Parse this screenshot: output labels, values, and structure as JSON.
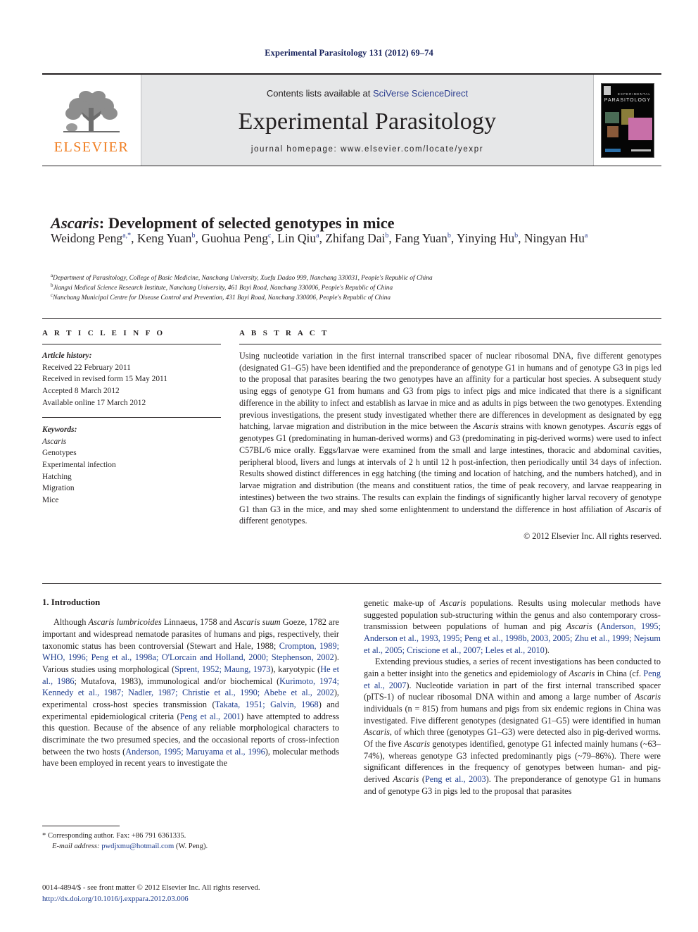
{
  "running_head": "Experimental Parasitology 131 (2012) 69–74",
  "masthead": {
    "contents_prefix": "Contents lists available at ",
    "contents_link": "SciVerse ScienceDirect",
    "journal_title": "Experimental Parasitology",
    "homepage": "journal homepage: www.elsevier.com/locate/yexpr",
    "publisher_logo_label": "ELSEVIER",
    "cover_line1": "EXPERIMENTAL",
    "cover_line2": "PARASITOLOGY"
  },
  "article": {
    "title_italic": "Ascaris",
    "title_rest": ": Development of selected genotypes in mice",
    "authors": [
      {
        "name": "Weidong Peng",
        "sup": "a,*"
      },
      {
        "name": "Keng Yuan",
        "sup": "b"
      },
      {
        "name": "Guohua Peng",
        "sup": "c"
      },
      {
        "name": "Lin Qiu",
        "sup": "a"
      },
      {
        "name": "Zhifang Dai",
        "sup": "b"
      },
      {
        "name": "Fang Yuan",
        "sup": "b"
      },
      {
        "name": "Yinying Hu",
        "sup": "b"
      },
      {
        "name": "Ningyan Hu",
        "sup": "a"
      }
    ],
    "affiliations": [
      {
        "mark": "a",
        "text": "Department of Parasitology, College of Basic Medicine, Nanchang University, Xuefu Dadao 999, Nanchang 330031, People's Republic of China"
      },
      {
        "mark": "b",
        "text": "Jiangxi Medical Science Research Institute, Nanchang University, 461 Bayi Road, Nanchang 330006, People's Republic of China"
      },
      {
        "mark": "c",
        "text": "Nanchang Municipal Centre for Disease Control and Prevention, 431 Bayi Road, Nanchang 330006, People's Republic of China"
      }
    ]
  },
  "info": {
    "heading": "A R T I C L E    I N F O",
    "history_label": "Article history:",
    "history": [
      "Received 22 February 2011",
      "Received in revised form 15 May 2011",
      "Accepted 8 March 2012",
      "Available online 17 March 2012"
    ],
    "keywords_label": "Keywords:",
    "keywords": [
      "Ascaris",
      "Genotypes",
      "Experimental infection",
      "Hatching",
      "Migration",
      "Mice"
    ]
  },
  "abstract": {
    "heading": "A B S T R A C T",
    "p1_a": "Using nucleotide variation in the first internal transcribed spacer of nuclear ribosomal DNA, five different genotypes (designated G1–G5) have been identified and the preponderance of genotype G1 in humans and of genotype G3 in pigs led to the proposal that parasites bearing the two genotypes have an affinity for a particular host species. A subsequent study using eggs of genotype G1 from humans and G3 from pigs to infect pigs and mice indicated that there is a significant difference in the ability to infect and establish as larvae in mice and as adults in pigs between the two genotypes. Extending previous investigations, the present study investigated whether there are differences in development as designated by egg hatching, larvae migration and distribution in the mice between the ",
    "p1_i1": "Ascaris",
    "p1_b": " strains with known genotypes. ",
    "p1_i2": "Ascaris",
    "p1_c": " eggs of genotypes G1 (predominating in human-derived worms) and G3 (predominating in pig-derived worms) were used to infect C57BL/6 mice orally. Eggs/larvae were examined from the small and large intestines, thoracic and abdominal cavities, peripheral blood, livers and lungs at intervals of 2 h until 12 h post-infection, then periodically until 34 days of infection. Results showed distinct differences in egg hatching (the timing and location of hatching, and the numbers hatched), and in larvae migration and distribution (the means and constituent ratios, the time of peak recovery, and larvae reappearing in intestines) between the two strains. The results can explain the findings of significantly higher larval recovery of genotype G1 than G3 in the mice, and may shed some enlightenment to understand the difference in host affiliation of ",
    "p1_i3": "Ascaris",
    "p1_d": " of different genotypes.",
    "copyright": "© 2012 Elsevier Inc. All rights reserved."
  },
  "body": {
    "section_heading": "1. Introduction",
    "left": {
      "p1_parts": [
        {
          "t": "Although ",
          "s": "n"
        },
        {
          "t": "Ascaris lumbricoides",
          "s": "i"
        },
        {
          "t": " Linnaeus, 1758 and ",
          "s": "n"
        },
        {
          "t": "Ascaris suum",
          "s": "i"
        },
        {
          "t": " Goeze, 1782 are important and widespread nematode parasites of humans and pigs, respectively, their taxonomic status has been controversial (Stewart and Hale, 1988; ",
          "s": "n"
        },
        {
          "t": "Crompton, 1989; WHO, 1996; Peng et al., 1998a; O'Lorcain and Holland, 2000; Stephenson, 2002",
          "s": "c"
        },
        {
          "t": "). Various studies using morphological (",
          "s": "n"
        },
        {
          "t": "Sprent, 1952; Maung, 1973",
          "s": "c"
        },
        {
          "t": "), karyotypic (",
          "s": "n"
        },
        {
          "t": "He et al., 1986",
          "s": "c"
        },
        {
          "t": "; Mutafova, 1983), immunological and/or biochemical (",
          "s": "n"
        },
        {
          "t": "Kurimoto, 1974; Kennedy et al., 1987; Nadler, 1987; Christie et al., 1990; Abebe et al., 2002",
          "s": "c"
        },
        {
          "t": "), experimental cross-host species transmission (",
          "s": "n"
        },
        {
          "t": "Takata, 1951; Galvin, 1968",
          "s": "c"
        },
        {
          "t": ") and experimental epidemiological criteria (",
          "s": "n"
        },
        {
          "t": "Peng et al., 2001",
          "s": "c"
        },
        {
          "t": ") have attempted to address this question. Because of the absence of any reliable morphological characters to discriminate the two presumed species, and the occasional reports of cross-infection between the two hosts (",
          "s": "n"
        },
        {
          "t": "Anderson, 1995; Maruyama et al., 1996",
          "s": "c"
        },
        {
          "t": "), molecular methods have been employed in recent years to investigate the",
          "s": "n"
        }
      ]
    },
    "right": {
      "p1_parts": [
        {
          "t": "genetic make-up of ",
          "s": "n"
        },
        {
          "t": "Ascaris",
          "s": "i"
        },
        {
          "t": " populations. Results using molecular methods have suggested population sub-structuring within the genus and also contemporary cross-transmission between populations of human and pig ",
          "s": "n"
        },
        {
          "t": "Ascaris",
          "s": "i"
        },
        {
          "t": " (",
          "s": "n"
        },
        {
          "t": "Anderson, 1995; Anderson et al., 1993, 1995; Peng et al., 1998b, 2003, 2005; Zhu et al., 1999; Nejsum et al., 2005; Criscione et al., 2007; Leles et al., 2010",
          "s": "c"
        },
        {
          "t": ").",
          "s": "n"
        }
      ],
      "p2_parts": [
        {
          "t": "Extending previous studies, a series of recent investigations has been conducted to gain a better insight into the genetics and epidemiology of ",
          "s": "n"
        },
        {
          "t": "Ascaris",
          "s": "i"
        },
        {
          "t": " in China (cf. ",
          "s": "n"
        },
        {
          "t": "Peng et al., 2007",
          "s": "c"
        },
        {
          "t": "). Nucleotide variation in part of the first internal transcribed spacer (pITS-1) of nuclear ribosomal DNA within and among a large number of ",
          "s": "n"
        },
        {
          "t": "Ascaris",
          "s": "i"
        },
        {
          "t": " individuals (n = 815) from humans and pigs from six endemic regions in China was investigated. Five different genotypes (designated G1–G5) were identified in human ",
          "s": "n"
        },
        {
          "t": "Ascaris",
          "s": "i"
        },
        {
          "t": ", of which three (genotypes G1–G3) were detected also in pig-derived worms. Of the five ",
          "s": "n"
        },
        {
          "t": "Ascaris",
          "s": "i"
        },
        {
          "t": " genotypes identified, genotype G1 infected mainly humans (~63–74%), whereas genotype G3 infected predominantly pigs (~79–86%). There were significant differences in the frequency of genotypes between human- and pig-derived ",
          "s": "n"
        },
        {
          "t": "Ascaris",
          "s": "i"
        },
        {
          "t": " (",
          "s": "n"
        },
        {
          "t": "Peng et al., 2003",
          "s": "c"
        },
        {
          "t": "). The preponderance of genotype G1 in humans and of genotype G3 in pigs led to the proposal that parasites",
          "s": "n"
        }
      ]
    }
  },
  "footnote": {
    "star": "*",
    "corresponding": "Corresponding author. Fax: +86 791 6361335.",
    "email_label": "E-mail address:",
    "email": "pwdjxmu@hotmail.com",
    "email_suffix": "(W. Peng)."
  },
  "footer": {
    "issn_line": "0014-4894/$ - see front matter © 2012 Elsevier Inc. All rights reserved.",
    "doi": "http://dx.doi.org/10.1016/j.exppara.2012.03.006"
  },
  "colors": {
    "link": "#1b3a8c",
    "elsevier_orange": "#f07c1e",
    "running_head": "#16215b",
    "masthead_gray": "#e6e7e8"
  }
}
